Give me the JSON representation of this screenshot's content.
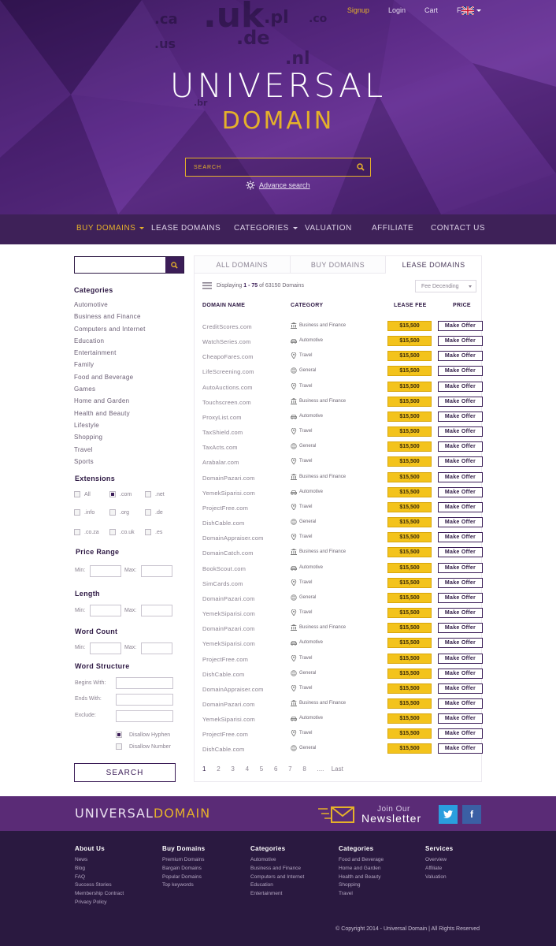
{
  "topnav": {
    "signup": "Signup",
    "login": "Login",
    "cart": "Cart",
    "faq": "FAQ"
  },
  "hero_tlds": [
    ".ca",
    ".us",
    ".uk",
    ".pl",
    ".de",
    ".nl",
    ".br",
    ".co"
  ],
  "brand": {
    "line1": "UNIVERSAL",
    "line2": "DOMAIN"
  },
  "search": {
    "placeholder": "SEARCH",
    "advanced": "Advance search"
  },
  "mainnav": [
    {
      "label": "BUY DOMAINS",
      "active": true,
      "dropdown": true
    },
    {
      "label": "LEASE DOMAINS"
    },
    {
      "label": "CATEGORIES",
      "dropdown": true
    },
    {
      "label": "VALUATION"
    },
    {
      "label": "AFFILIATE"
    },
    {
      "label": "CONTACT US"
    }
  ],
  "sidebar": {
    "categories_title": "Categories",
    "categories": [
      "Automotive",
      "Business and Finance",
      "Computers and Internet",
      "Education",
      "Entertainment",
      "Family",
      "Food and Beverage",
      "Games",
      "Home and Garden",
      "Health and Beauty",
      "Lifestyle",
      "Shopping",
      "Travel",
      "Sports"
    ],
    "extensions_title": "Extensions",
    "extensions": [
      "All",
      ".com",
      ".net",
      ".info",
      ".org",
      ".de",
      ".co.za",
      ".co.uk",
      ".es"
    ],
    "price_title": "Price Range",
    "length_title": "Length",
    "wordcount_title": "Word Count",
    "min": "Min:",
    "max": "Max:",
    "structure_title": "Word Structure",
    "begins": "Begins With:",
    "ends": "Ends With:",
    "exclude": "Exclude:",
    "hyphen": "Disallow Hyphen",
    "number": "Disallow Number",
    "button": "SEARCH"
  },
  "tabs": [
    "ALL DOMAINS",
    "BUY DOMAINS",
    "LEASE DOMAINS"
  ],
  "listing": {
    "displaying": "Displaying",
    "range": "1 - 75",
    "of": "of",
    "total": "63150",
    "unit": "Domains",
    "sort": "Fee Decending",
    "headers": {
      "name": "DOMAIN NAME",
      "category": "CATEGORY",
      "fee": "LEASE FEE",
      "price": "PRICE"
    },
    "offer_label": "Make Offer",
    "rows": [
      {
        "name": "CreditScores.com",
        "cat": "Business and Finance",
        "icon": "bank-icon",
        "fee": "$15,500"
      },
      {
        "name": "WatchSeries.com",
        "cat": "Automotive",
        "icon": "car-icon",
        "fee": "$15,500"
      },
      {
        "name": "CheapoFares.com",
        "cat": "Travel",
        "icon": "pin-icon",
        "fee": "$15,500"
      },
      {
        "name": "LifeScreening.com",
        "cat": "General",
        "icon": "globe-icon",
        "fee": "$15,500"
      },
      {
        "name": "AutoAuctions.com",
        "cat": "Travel",
        "icon": "pin-icon",
        "fee": "$15,500"
      },
      {
        "name": "Touchscreen.com",
        "cat": "Business and Finance",
        "icon": "bank-icon",
        "fee": "$15,500"
      },
      {
        "name": "ProxyList.com",
        "cat": "Automotive",
        "icon": "car-icon",
        "fee": "$15,500"
      },
      {
        "name": "TaxShield.com",
        "cat": "Travel",
        "icon": "pin-icon",
        "fee": "$15,500"
      },
      {
        "name": "TaxActs.com",
        "cat": "General",
        "icon": "globe-icon",
        "fee": "$15,500"
      },
      {
        "name": "Arabalar.com",
        "cat": "Travel",
        "icon": "pin-icon",
        "fee": "$15,500"
      },
      {
        "name": "DomainPazari.com",
        "cat": "Business and Finance",
        "icon": "bank-icon",
        "fee": "$15,500"
      },
      {
        "name": "YemekSiparisi.com",
        "cat": "Automotive",
        "icon": "car-icon",
        "fee": "$15,500"
      },
      {
        "name": "ProjectFree.com",
        "cat": "Travel",
        "icon": "pin-icon",
        "fee": "$15,500"
      },
      {
        "name": "DishCable.com",
        "cat": "General",
        "icon": "globe-icon",
        "fee": "$15,500"
      },
      {
        "name": "DomainAppraiser.com",
        "cat": "Travel",
        "icon": "pin-icon",
        "fee": "$15,500"
      },
      {
        "name": "DomainCatch.com",
        "cat": "Business and Finance",
        "icon": "bank-icon",
        "fee": "$15,500"
      },
      {
        "name": "BookScout.com",
        "cat": "Automotive",
        "icon": "car-icon",
        "fee": "$15,500"
      },
      {
        "name": "SimCards.com",
        "cat": "Travel",
        "icon": "pin-icon",
        "fee": "$15,500"
      },
      {
        "name": "DomainPazari.com",
        "cat": "General",
        "icon": "globe-icon",
        "fee": "$15,500"
      },
      {
        "name": "YemekSiparisi.com",
        "cat": "Travel",
        "icon": "pin-icon",
        "fee": "$15,500"
      },
      {
        "name": "DomainPazari.com",
        "cat": "Business and Finance",
        "icon": "bank-icon",
        "fee": "$15,500"
      },
      {
        "name": "YemekSiparisi.com",
        "cat": "Automotive",
        "icon": "car-icon",
        "fee": "$15,500"
      },
      {
        "name": "ProjectFree.com",
        "cat": "Travel",
        "icon": "pin-icon",
        "fee": "$15,500"
      },
      {
        "name": "DishCable.com",
        "cat": "General",
        "icon": "globe-icon",
        "fee": "$15,500"
      },
      {
        "name": "DomainAppraiser.com",
        "cat": "Travel",
        "icon": "pin-icon",
        "fee": "$15,500"
      },
      {
        "name": "DomainPazari.com",
        "cat": "Business and Finance",
        "icon": "bank-icon",
        "fee": "$15,500"
      },
      {
        "name": "YemekSiparisi.com",
        "cat": "Automotive",
        "icon": "car-icon",
        "fee": "$15,500"
      },
      {
        "name": "ProjectFree.com",
        "cat": "Travel",
        "icon": "pin-icon",
        "fee": "$15,500"
      },
      {
        "name": "DishCable.com",
        "cat": "General",
        "icon": "globe-icon",
        "fee": "$15,500"
      }
    ],
    "pages": [
      "1",
      "2",
      "3",
      "4",
      "5",
      "6",
      "7",
      "8",
      "....",
      "Last"
    ]
  },
  "footer": {
    "brand1": "UNIVERSAL",
    "brand2": "DOMAIN",
    "join": "Join Our",
    "newsletter": "Newsletter",
    "columns": [
      {
        "title": "About Us",
        "links": [
          "News",
          "Blog",
          "FAQ",
          "Success Stories",
          "Membership Contract",
          "Privacy Policy"
        ]
      },
      {
        "title": "Buy Domains",
        "links": [
          "Premium Domains",
          "Bargain Domains",
          "Popular Domains",
          "Top keywords"
        ]
      },
      {
        "title": "Categories",
        "links": [
          "Automotive",
          "Business and Finance",
          "Computers and Internet",
          "Education",
          "Entertainment"
        ]
      },
      {
        "title": "Categories",
        "links": [
          "Food and Beverage",
          "Home and Garden",
          "Health and Beauty",
          "Shopping",
          "Travel"
        ]
      },
      {
        "title": "Services",
        "links": [
          "Overview",
          "Affiliate",
          "Valuation"
        ]
      }
    ],
    "copyright": "© Copyright 2014 - Universal Domain   |   All Rights Reserved"
  },
  "colors": {
    "accent": "#e5b12a",
    "purple_dark": "#3e2158",
    "purple": "#5a2b76",
    "fee_yellow": "#f3c31c"
  }
}
